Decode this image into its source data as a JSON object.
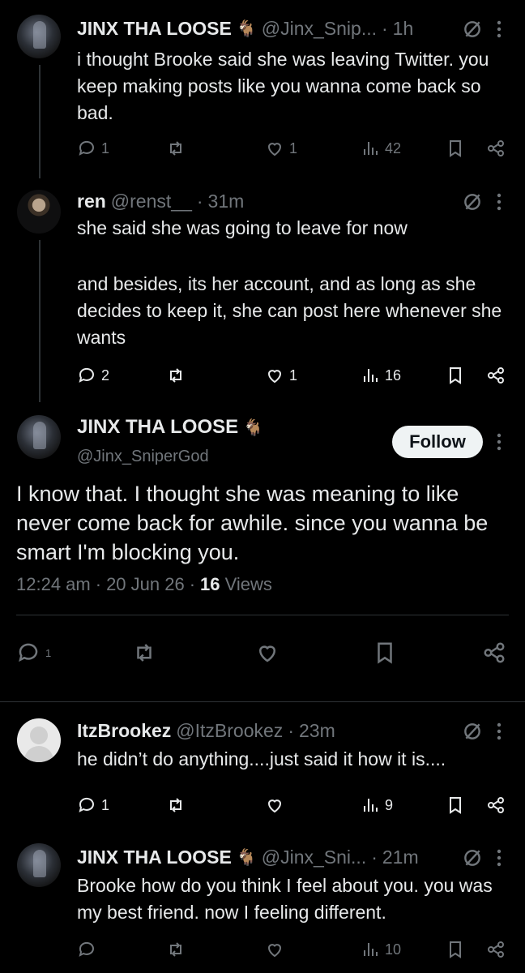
{
  "tweets": [
    {
      "name": "JINX THA LOOSE",
      "emoji": "🐐",
      "handle": "@Jinx_Snip...",
      "time": "1h",
      "text": "i thought Brooke said she was leaving Twitter. you keep making posts like you wanna come back so bad.",
      "replies": "1",
      "likes": "1",
      "views": "42"
    },
    {
      "name": "ren",
      "handle": "@renst__",
      "time": "31m",
      "text_line1": "she said she was going to leave for now",
      "text_line2": "and besides,  its her account, and as long as she decides to keep it, she can post here whenever she wants",
      "replies": "2",
      "likes": "1",
      "views": "16"
    },
    {
      "name": "ItzBrookez",
      "handle": "@ItzBrookez",
      "time": "23m",
      "text": "he didn’t do anything....just said it how it is....",
      "replies": "1",
      "likes": "",
      "views": "9"
    },
    {
      "name": "JINX THA LOOSE",
      "emoji": "🐐",
      "handle": "@Jinx_Sni...",
      "time": "21m",
      "text": "Brooke how do you think I feel about you. you was my best friend. now I feeling different.",
      "replies": "",
      "likes": "",
      "views": "10"
    }
  ],
  "main": {
    "name": "JINX THA LOOSE",
    "emoji": "🐐",
    "handle": "@Jinx_SniperGod",
    "follow_label": "Follow",
    "text": "I know that. I thought she was meaning to like never come back for awhile. since you wanna be smart I'm blocking you.",
    "time": "12:24 am",
    "date": "20 Jun 26",
    "views_count": "16",
    "views_label": "Views",
    "replies": "1"
  },
  "dot": "·"
}
